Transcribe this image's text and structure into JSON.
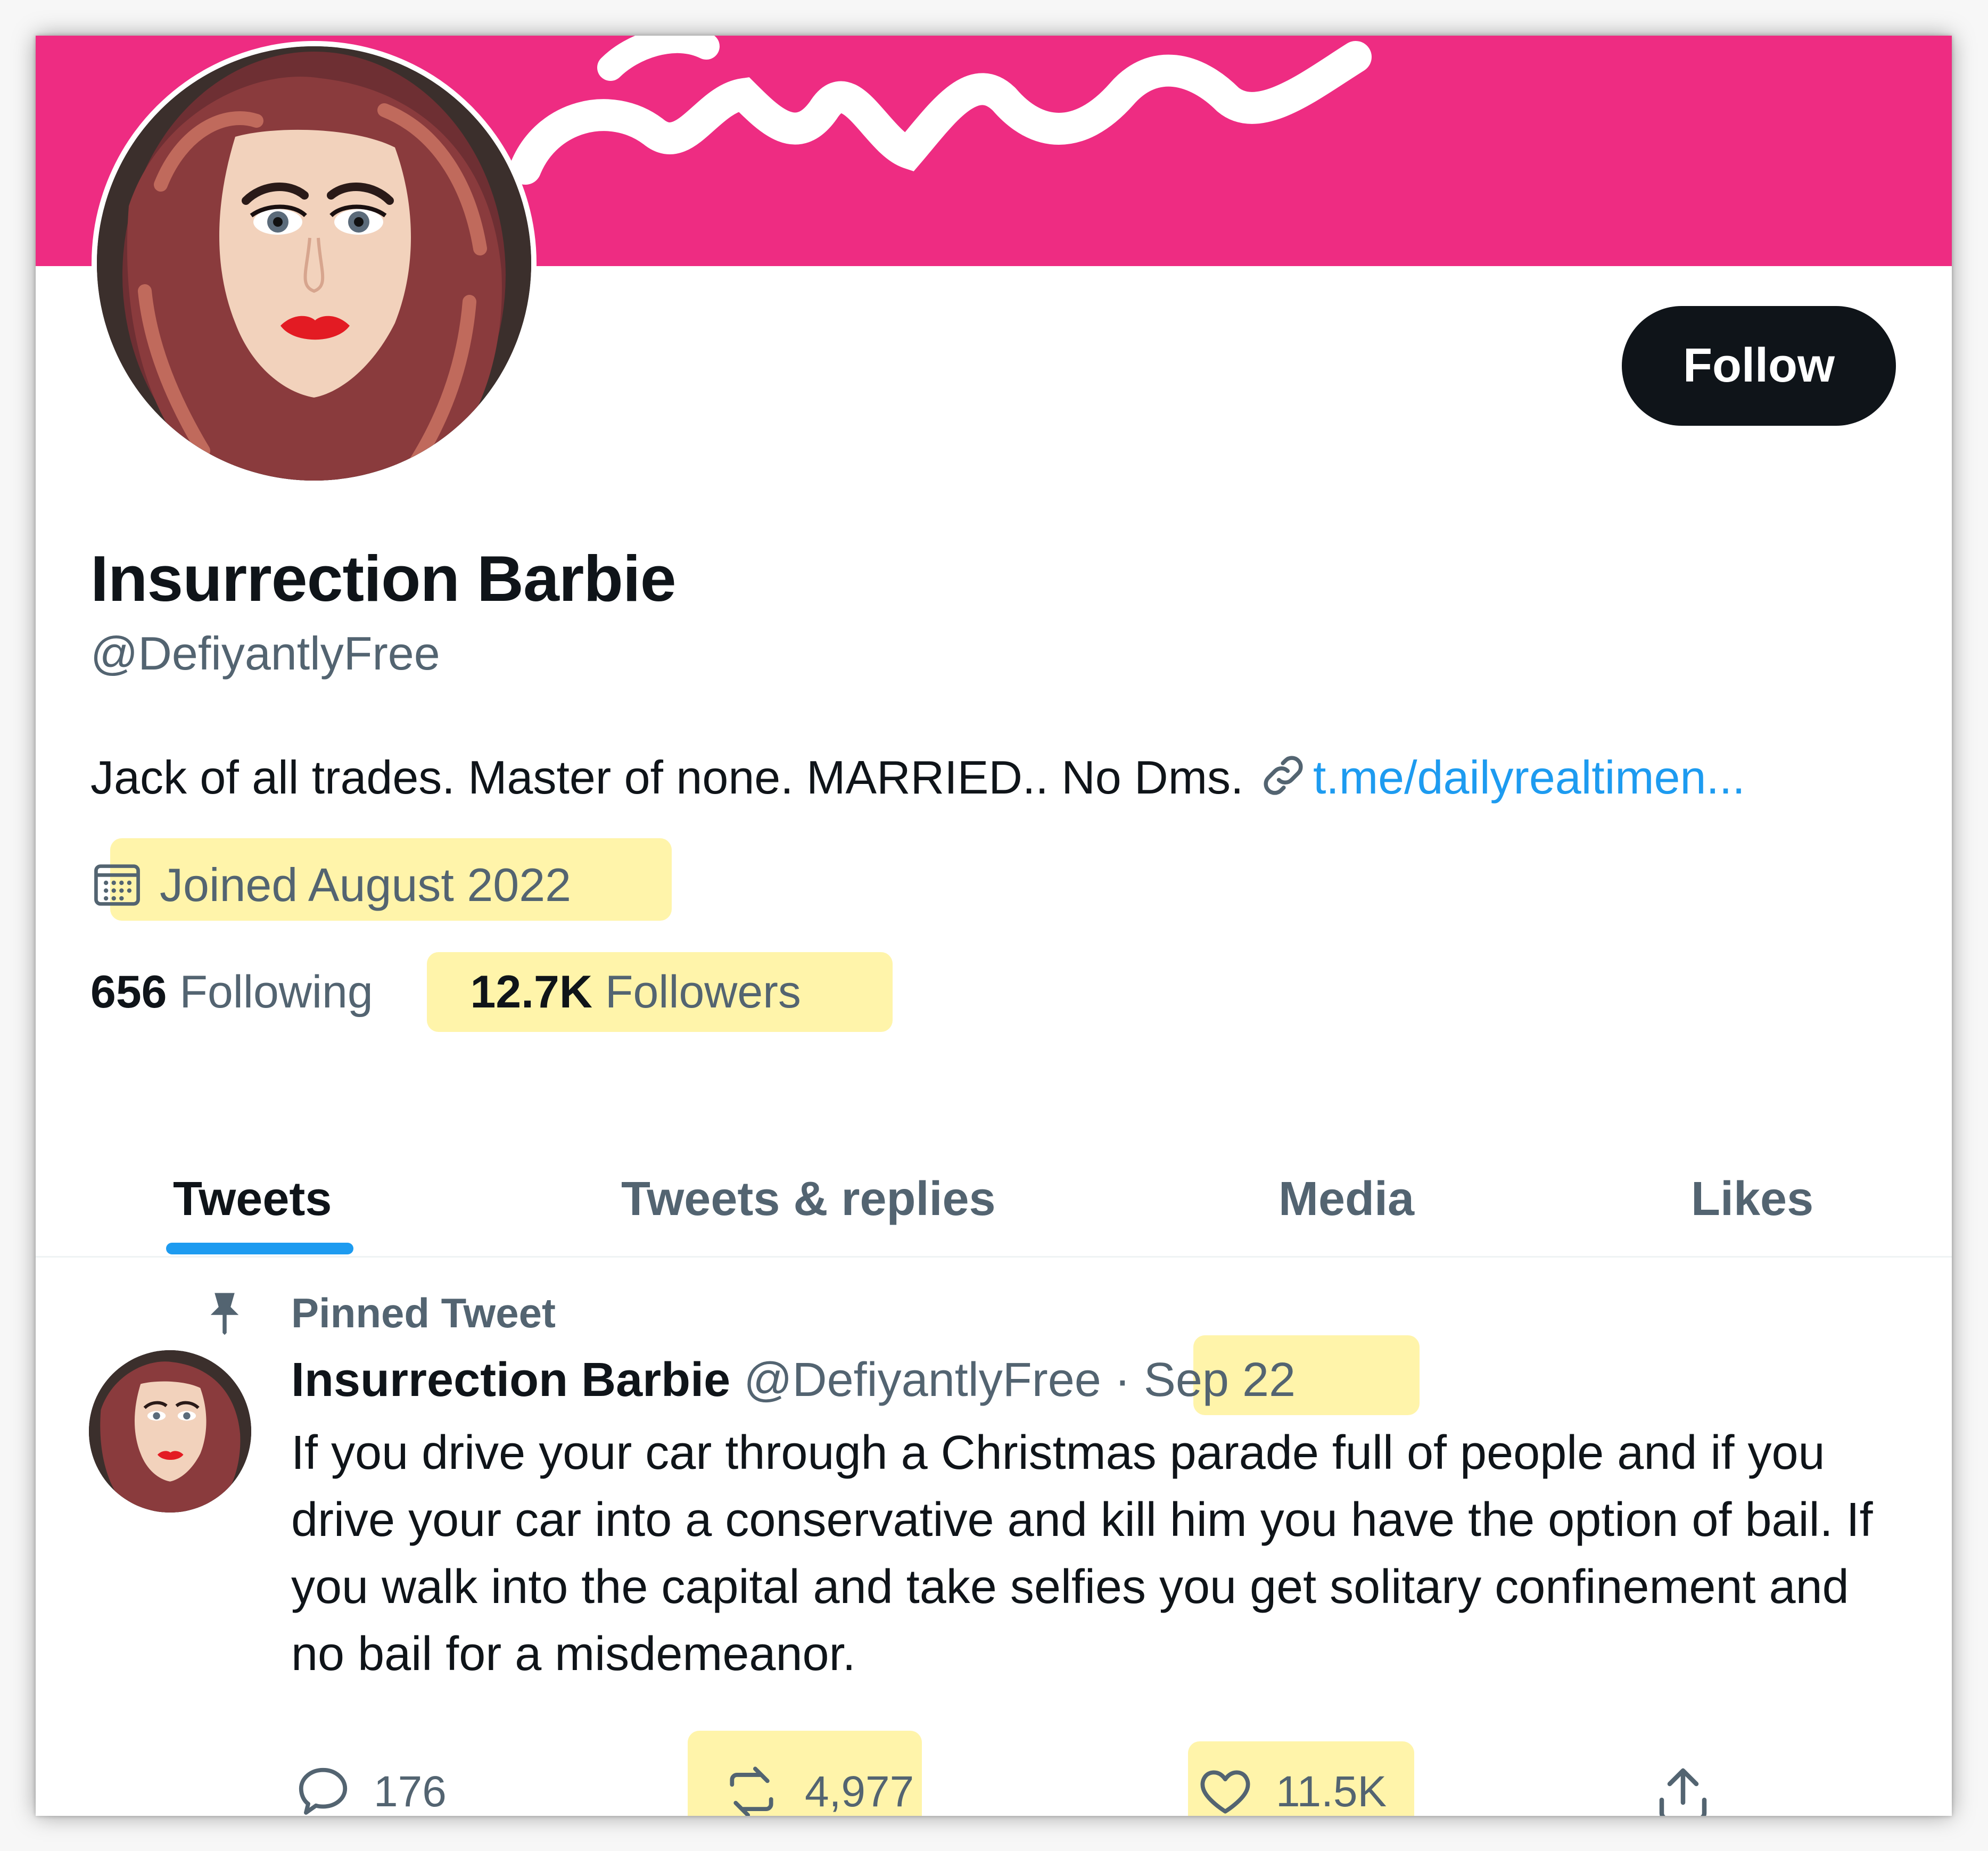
{
  "profile": {
    "name": "Insurrection Barbie",
    "handle": "@DefiyantlyFree",
    "follow_label": "Follow",
    "bio": "Jack of all trades. Master of none. MARRIED.. No Dms.",
    "bio_link": "t.me/dailyrealtimen...",
    "joined": "Joined August 2022",
    "following_count": "656",
    "following_label": "Following",
    "followers_count": "12.7K",
    "followers_label": "Followers"
  },
  "tabs": [
    {
      "label": "Tweets"
    },
    {
      "label": "Tweets & replies"
    },
    {
      "label": "Media"
    },
    {
      "label": "Likes"
    }
  ],
  "tweet": {
    "pinned_label": "Pinned Tweet",
    "author": "Insurrection Barbie",
    "handle": "@DefiyantlyFree",
    "separator": "·",
    "date": "Sep 22",
    "text": "If you drive your car through a Christmas parade full of people and if you drive your car into a conservative and kill him you have the option of bail. If you walk into the capital and take selfies you get solitary confinement and no bail for a misdemeanor.",
    "replies": "176",
    "retweets": "4,977",
    "likes": "11.5K"
  },
  "colors": {
    "banner": "#ee2c82",
    "accent": "#1d9bf0",
    "highlight": "#fff29b"
  },
  "icons": [
    "link-icon",
    "calendar-icon",
    "pin-icon",
    "reply-icon",
    "retweet-icon",
    "like-icon",
    "share-icon"
  ]
}
